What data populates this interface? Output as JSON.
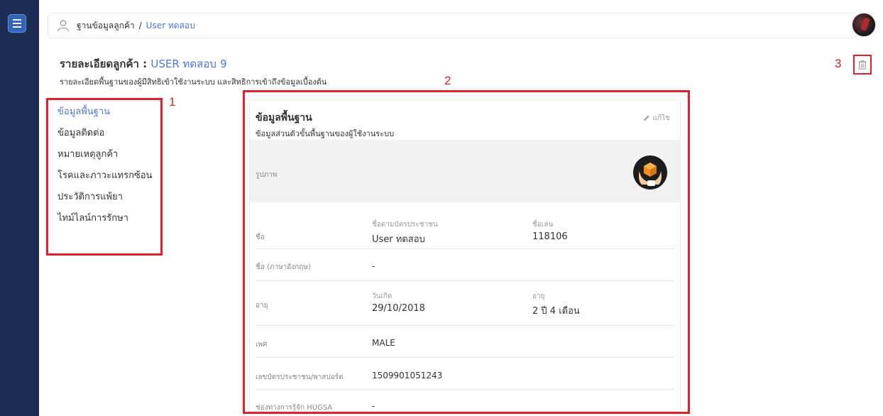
{
  "breadcrumb": {
    "section": "ฐานข้อมูลลูกค้า",
    "separator": "/",
    "current": "User ทดสอบ"
  },
  "header": {
    "title_label": "รายละเอียดลูกค้า :",
    "customer_name": "USER ทดสอบ",
    "customer_no": "9",
    "subtitle": "รายละเอียดพื้นฐานของผู้มีสิทธิเข้าใช้งานระบบ และสิทธิการเข้าถึงข้อมูลเบื้องต้น"
  },
  "annotations": {
    "a1": "1",
    "a2": "2",
    "a3": "3"
  },
  "nav": {
    "items": [
      {
        "label": "ข้อมูลพื้นฐาน",
        "active": true
      },
      {
        "label": "ข้อมูลติดต่อ"
      },
      {
        "label": "หมายเหตุลูกค้า"
      },
      {
        "label": "โรคและภาวะแทรกซ้อน"
      },
      {
        "label": "ประวัติการแพ้ยา"
      },
      {
        "label": "ไทม์ไลน์การรักษา"
      }
    ]
  },
  "card": {
    "title": "ข้อมูลพื้นฐาน",
    "desc": "ข้อมูลส่วนตัวขั้นพื้นฐานของผู้ใช้งานระบบ",
    "edit_label": "แก้ไข",
    "photo_label": "รูปภาพ",
    "name": {
      "label": "ชื่อ",
      "id_name_caption": "ชื่อตามบัตรประชาชน",
      "id_name_value": "User ทดสอบ",
      "nickname_caption": "ชื่อเล่น",
      "nickname_value": "118106"
    },
    "name_en": {
      "label": "ชื่อ (ภาษาอังกฤษ)",
      "value": "-"
    },
    "age": {
      "label": "อายุ",
      "birth_caption": "วันเกิด",
      "birth_value": "29/10/2018",
      "age_caption": "อายุ",
      "age_value": "2 ปี 4 เดือน"
    },
    "gender": {
      "label": "เพศ",
      "value": "MALE"
    },
    "id_card": {
      "label": "เลขบัตรประชาชน/พาสปอร์ต",
      "value": "1509901051243"
    },
    "channel": {
      "label": "ช่องทางการรู้จัก HUGSA",
      "value": "-"
    }
  },
  "colors": {
    "sidebar": "#1d2c52",
    "accent": "#4a78d8",
    "annotation": "#e0202a"
  }
}
